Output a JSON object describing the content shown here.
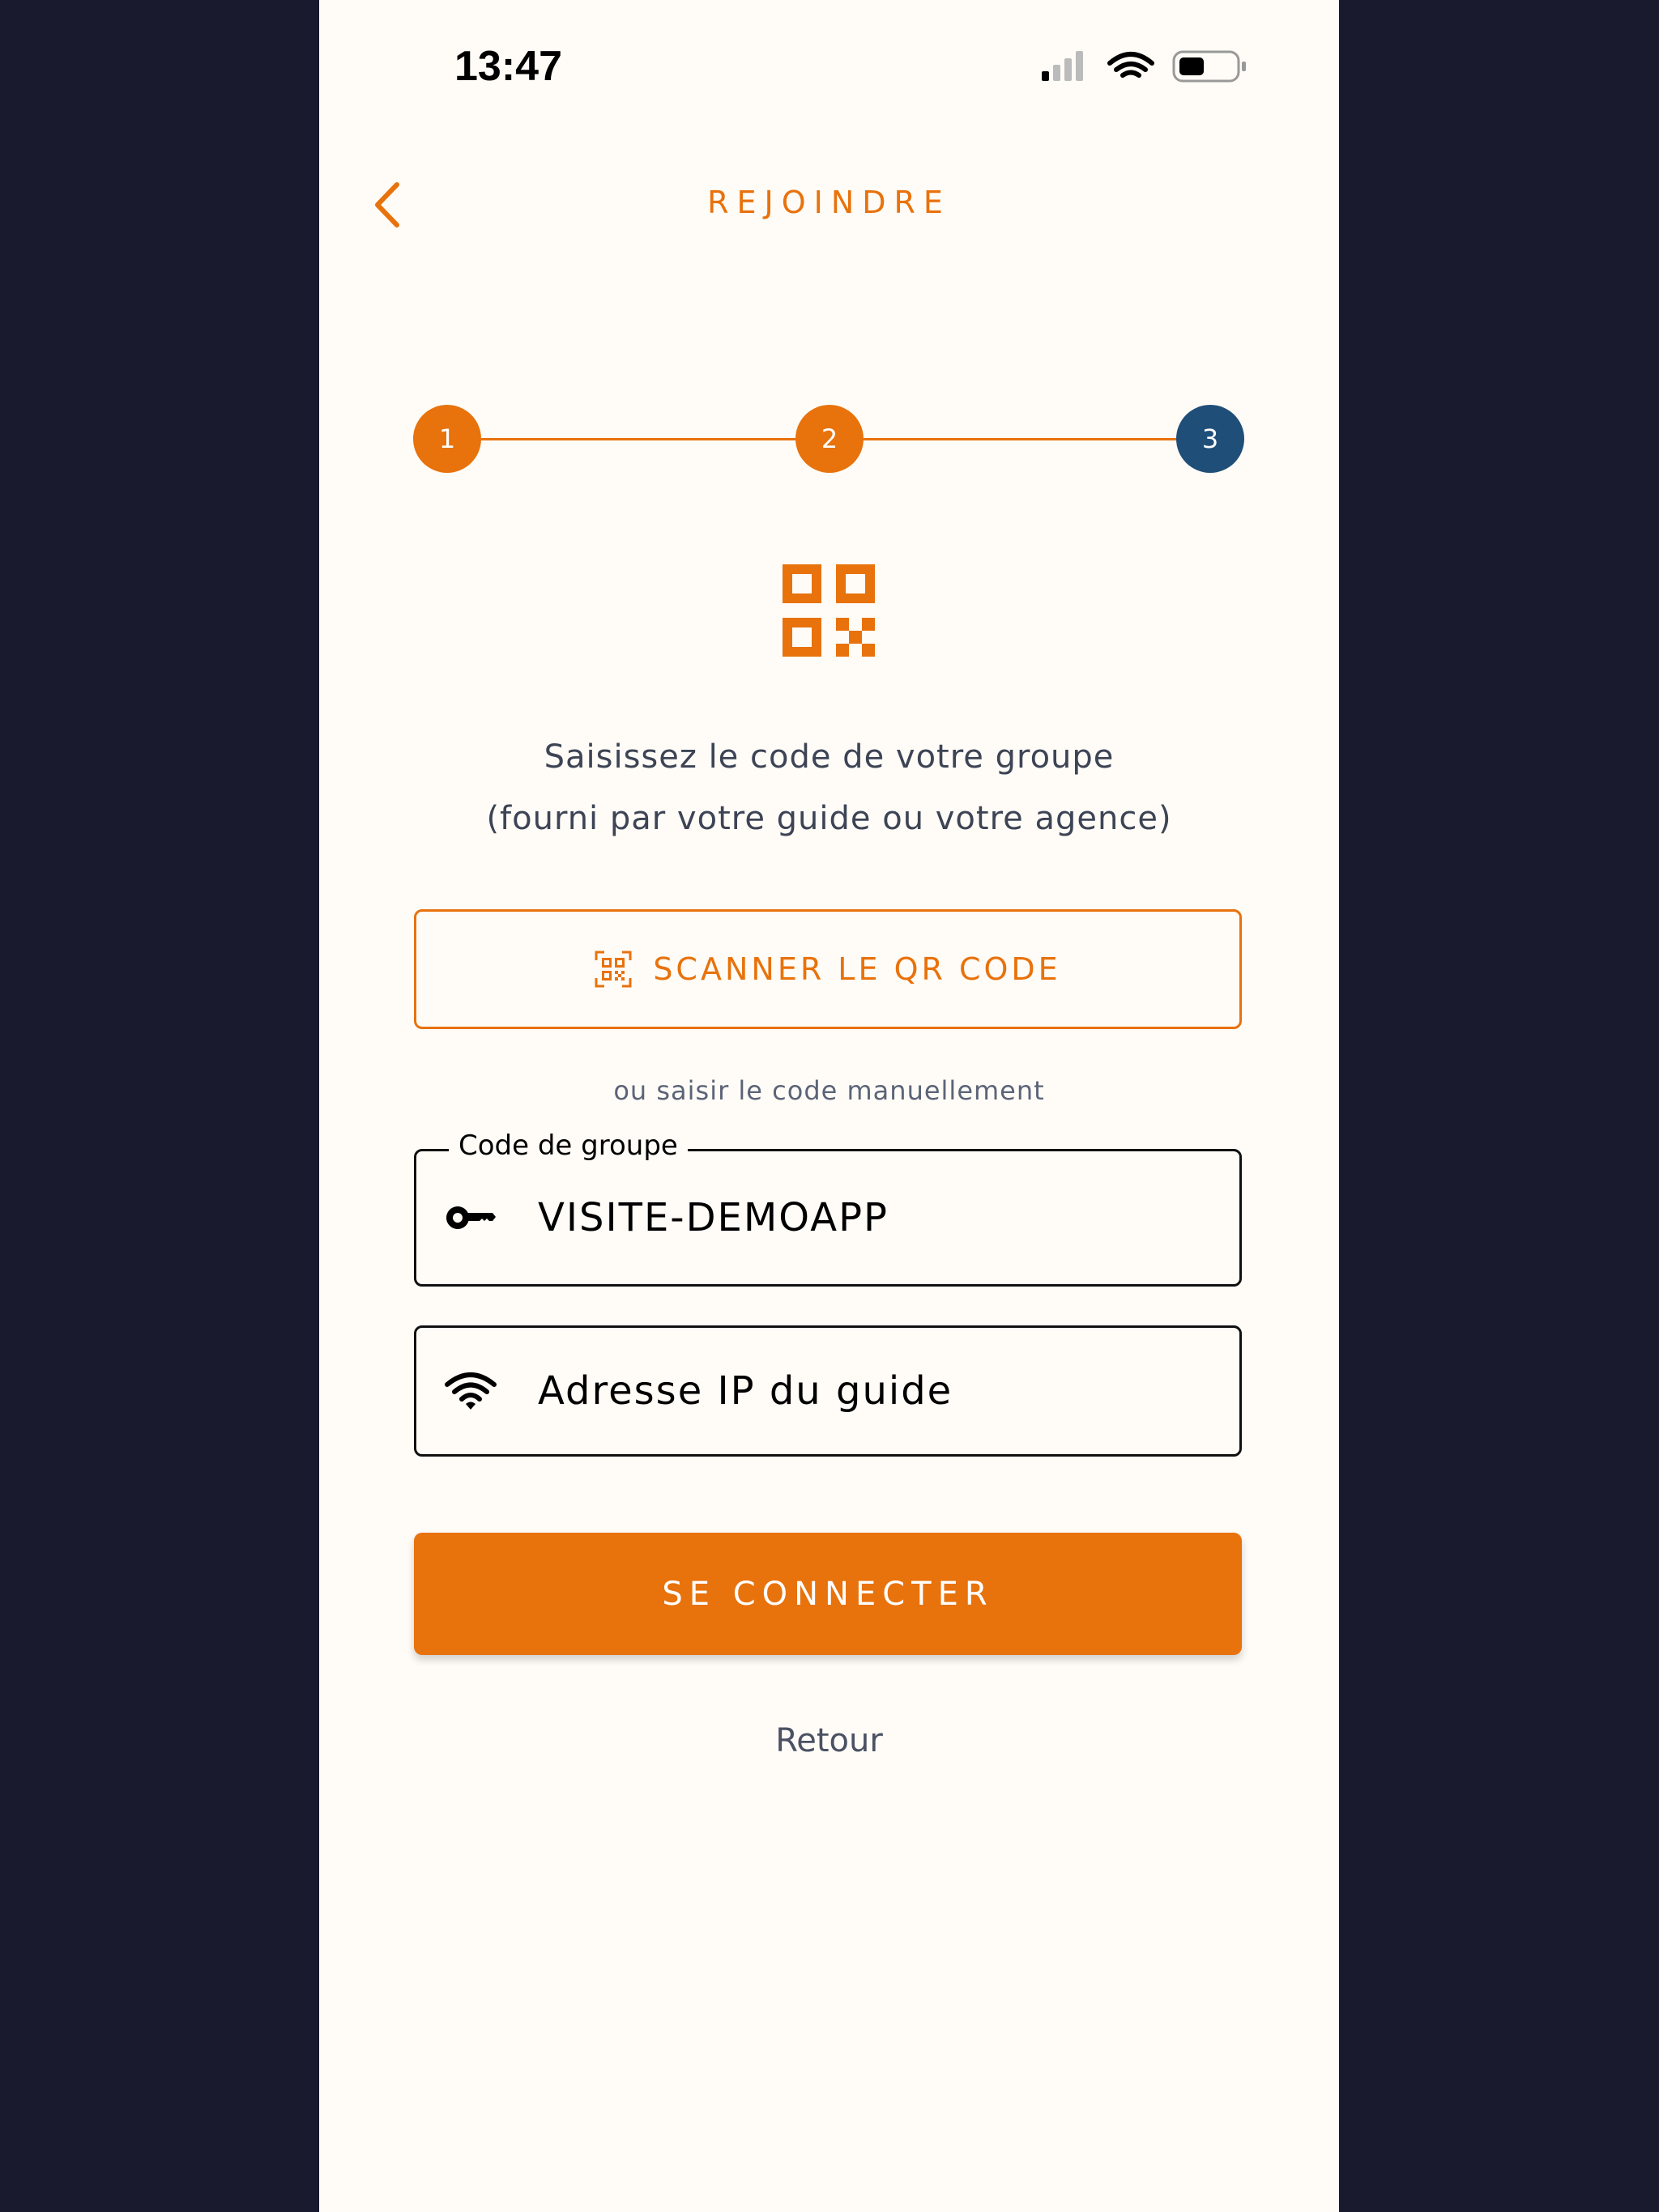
{
  "status_bar": {
    "time": "13:47"
  },
  "header": {
    "title": "REJOINDRE",
    "back_icon": "chevron-left-icon"
  },
  "stepper": {
    "steps": [
      {
        "label": "1",
        "state": "completed",
        "color": "#e8720c"
      },
      {
        "label": "2",
        "state": "completed",
        "color": "#e8720c"
      },
      {
        "label": "3",
        "state": "current",
        "color": "#1f4e79"
      }
    ]
  },
  "instructions": {
    "line1": "Saisissez le code de votre groupe",
    "line2": "(fourni par votre guide ou votre agence)"
  },
  "scan_button": {
    "label": "SCANNER LE QR CODE",
    "icon": "qr-scan-icon"
  },
  "or_text": "ou saisir le code manuellement",
  "group_code_field": {
    "label": "Code de groupe",
    "value": "VISITE-DEMOAPP",
    "icon": "key-icon"
  },
  "ip_field": {
    "placeholder": "Adresse IP du guide",
    "icon": "wifi-icon"
  },
  "connect_button": {
    "label": "SE CONNECTER"
  },
  "back_link": {
    "label": "Retour"
  },
  "colors": {
    "accent": "#e8720c",
    "step_current": "#1f4e79",
    "background": "#fffcf7",
    "outer_background": "#1a1a2e"
  }
}
